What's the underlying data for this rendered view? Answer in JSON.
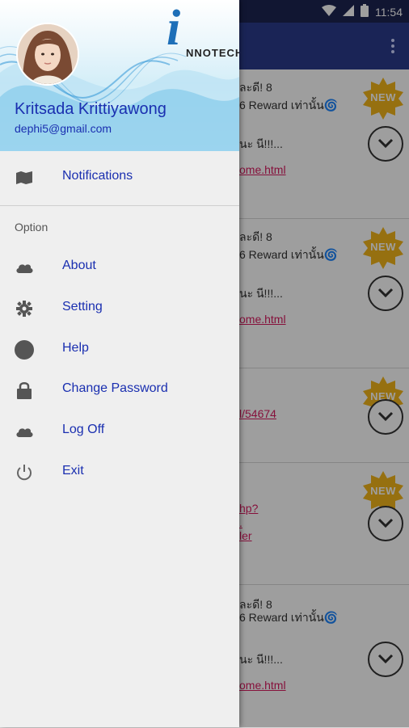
{
  "status_bar": {
    "time": "11:54"
  },
  "drawer": {
    "logo_letter": "i",
    "logo_text": "NNOTECH",
    "user": {
      "name": "Kritsada Krittiyawong",
      "email": "dephi5@gmail.com"
    },
    "top_items": [
      {
        "label": "Notifications",
        "icon": "notifications-icon"
      }
    ],
    "section_title": "Option",
    "option_items": [
      {
        "label": "About",
        "icon": "cloud-icon"
      },
      {
        "label": "Setting",
        "icon": "gear-icon"
      },
      {
        "label": "Help",
        "icon": "help-icon"
      },
      {
        "label": "Change Password",
        "icon": "lock-icon"
      },
      {
        "label": "Log Off",
        "icon": "cloud-icon"
      },
      {
        "label": "Exit",
        "icon": "power-icon"
      }
    ]
  },
  "feed": {
    "badge_label": "NEW",
    "cards": [
      {
        "line1": "ละดี! 8",
        "line2": "6 Reward เท่านั้น🌀",
        "line3": "นะ นี!!!...",
        "link": "ome.html"
      },
      {
        "line1": "ละดี! 8",
        "line2": "6 Reward เท่านั้น🌀",
        "line3": "นะ นี!!!...",
        "link": "ome.html"
      },
      {
        "link": "l/54674"
      },
      {
        "link1": "hp?",
        "link2": ".",
        "link3": "ler"
      },
      {
        "line1": "ละดี! 8",
        "line2": "6 Reward เท่านั้น🌀",
        "line3": "นะ นี!!!...",
        "link": "ome.html"
      }
    ]
  },
  "colors": {
    "drawer_text": "#1a2fb0",
    "appbar": "#2b3a8c",
    "badge": "#f2b51b",
    "link": "#d81b60"
  }
}
